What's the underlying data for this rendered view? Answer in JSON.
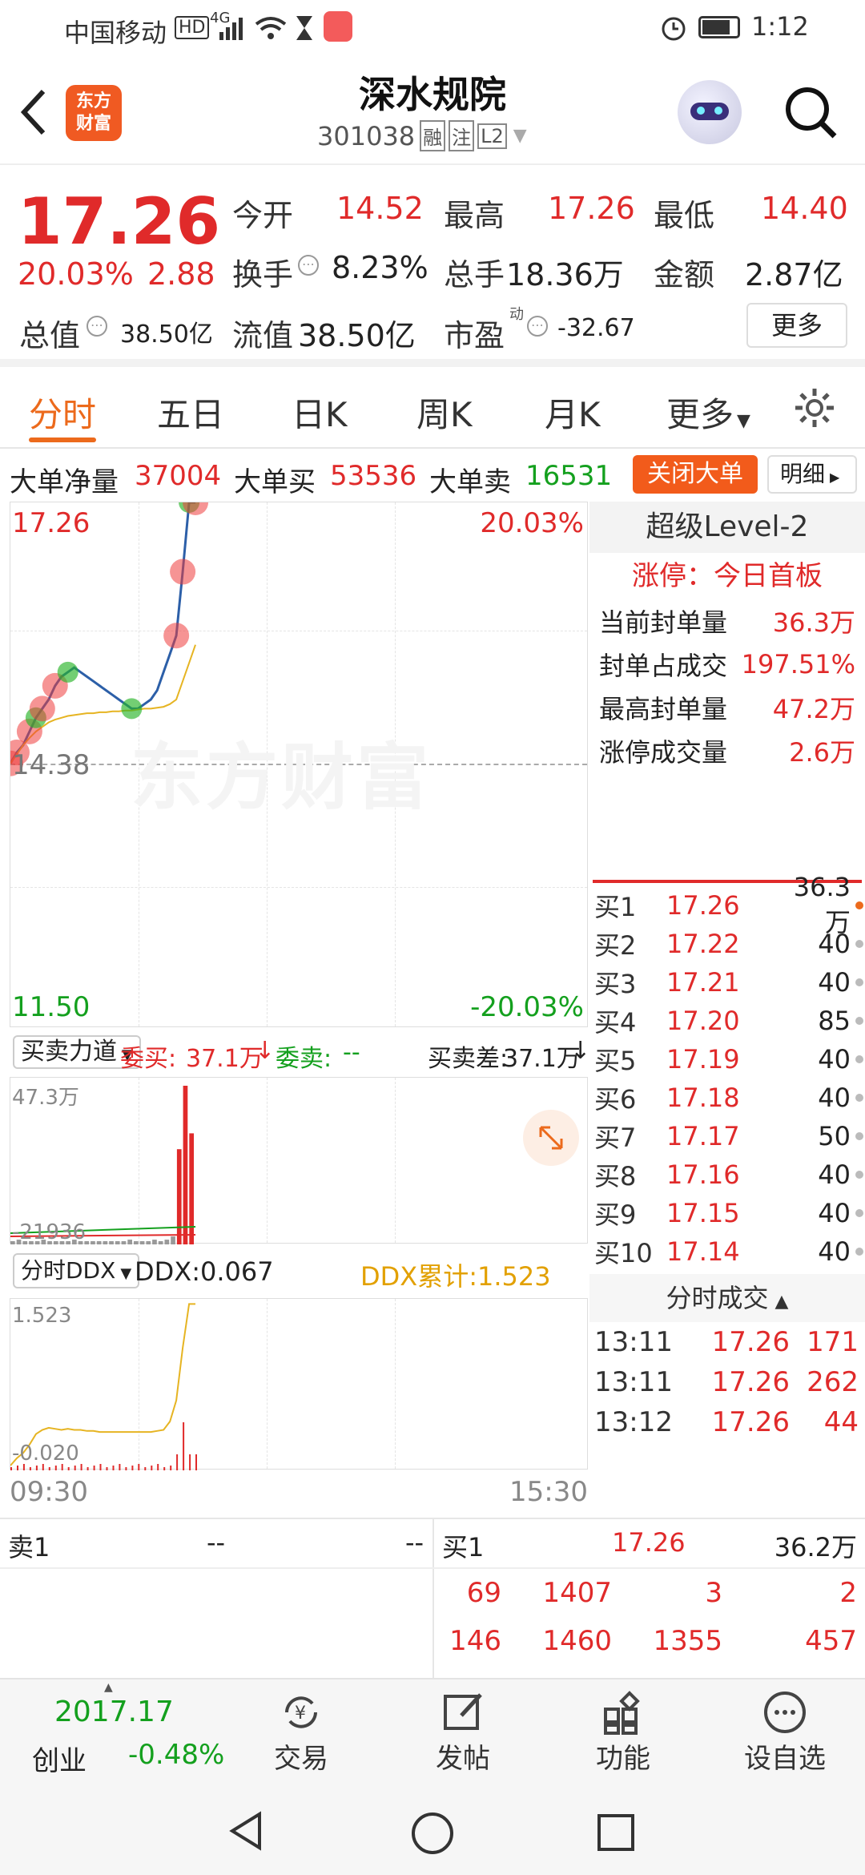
{
  "status": {
    "carrier": "中国移动",
    "hd": "HD",
    "net": "4G",
    "time": "1:12"
  },
  "header": {
    "logo_line1": "东方",
    "logo_line2": "财富",
    "title": "深水规院",
    "code": "301038",
    "tag1": "融",
    "tag2": "注",
    "tag3": "L2"
  },
  "quote": {
    "price": "17.26",
    "change_pct": "20.03%",
    "change": "2.88",
    "open_label": "今开",
    "open": "14.52",
    "high_label": "最高",
    "high": "17.26",
    "low_label": "最低",
    "low": "14.40",
    "turnover_label": "换手",
    "turnover": "8.23%",
    "volume_label": "总手",
    "volume": "18.36万",
    "amount_label": "金额",
    "amount": "2.87亿",
    "mktcap_label": "总值",
    "mktcap": "38.50亿",
    "float_label": "流值",
    "float_cap": "38.50亿",
    "pe_label": "市盈",
    "pe_sup": "动",
    "pe": "-32.67",
    "more_button": "更多"
  },
  "tabs": [
    "分时",
    "五日",
    "日K",
    "周K",
    "月K",
    "更多"
  ],
  "bigorder": {
    "net_label": "大单净量",
    "net": "37004",
    "buy_label": "大单买",
    "buy": "53536",
    "sell_label": "大单卖",
    "sell": "16531",
    "close_btn": "关闭大单",
    "detail_btn": "明细"
  },
  "main_chart": {
    "top_price": "17.26",
    "top_pct": "20.03%",
    "mid_price": "14.38",
    "bottom_price": "11.50",
    "bottom_pct": "-20.03%",
    "watermark": "东方财富"
  },
  "chart_data": [
    {
      "type": "line",
      "series": [
        {
          "values": [
            14.4,
            14.52,
            14.6,
            14.75,
            14.9,
            15.0,
            15.1,
            15.25,
            15.35,
            15.4,
            15.45,
            15.4,
            15.35,
            15.3,
            15.25,
            15.2,
            15.15,
            15.1,
            15.05,
            15.0,
            15.0,
            15.05,
            15.1,
            15.2,
            15.4,
            15.6,
            15.8,
            16.5,
            17.26,
            17.26
          ]
        },
        {
          "values": [
            14.4,
            14.5,
            14.6,
            14.68,
            14.75,
            14.8,
            14.85,
            14.88,
            14.9,
            14.92,
            14.93,
            14.94,
            14.95,
            14.95,
            14.96,
            14.96,
            14.97,
            14.97,
            14.98,
            14.98,
            14.99,
            15.0,
            15.0,
            15.01,
            15.02,
            15.05,
            15.1,
            15.3,
            15.5,
            15.7
          ]
        }
      ],
      "ylim": [
        11.5,
        17.26
      ]
    },
    {
      "type": "bar",
      "values": [
        2,
        3,
        2,
        2,
        2,
        3,
        2,
        2,
        2,
        2,
        3,
        2,
        2,
        2,
        2,
        2,
        2,
        2,
        2,
        3,
        2,
        2,
        2,
        3,
        2,
        3,
        5,
        60,
        100,
        70
      ],
      "ylim": [
        0,
        47.3
      ]
    },
    {
      "type": "line",
      "series": [
        {
          "values": [
            -0.02,
            0.05,
            0.1,
            0.18,
            0.28,
            0.32,
            0.34,
            0.33,
            0.32,
            0.33,
            0.32,
            0.32,
            0.31,
            0.31,
            0.3,
            0.3,
            0.3,
            0.3,
            0.3,
            0.3,
            0.3,
            0.3,
            0.3,
            0.31,
            0.32,
            0.4,
            0.6,
            1.1,
            1.52,
            1.52
          ]
        }
      ],
      "ylim": [
        -0.02,
        1.523
      ]
    }
  ],
  "volume_panel": {
    "selector": "买卖力道",
    "weibuy_label": "委买:",
    "weibuy": "37.1万",
    "weisell_label": "委卖:",
    "weisell": "--",
    "diff_label": "买卖差:",
    "diff": "37.1万",
    "top": "47.3万",
    "bottom": "-21936"
  },
  "ddx_panel": {
    "selector": "分时DDX",
    "ddx": "DDX:0.067",
    "ddx_sum": "DDX累计:1.523",
    "top": "1.523",
    "bottom": "-0.020"
  },
  "time_axis": {
    "start": "09:30",
    "end": "15:30"
  },
  "right_panel": {
    "title": "超级Level-2",
    "limit_text": "涨停：今日首板",
    "rows": [
      {
        "label": "当前封单量",
        "value": "36.3万"
      },
      {
        "label": "封单占成交",
        "value": "197.51%"
      },
      {
        "label": "最高封单量",
        "value": "47.2万"
      },
      {
        "label": "涨停成交量",
        "value": "2.6万"
      }
    ],
    "bids": [
      {
        "label": "买1",
        "price": "17.26",
        "qty": "36.3万"
      },
      {
        "label": "买2",
        "price": "17.22",
        "qty": "40"
      },
      {
        "label": "买3",
        "price": "17.21",
        "qty": "40"
      },
      {
        "label": "买4",
        "price": "17.20",
        "qty": "85"
      },
      {
        "label": "买5",
        "price": "17.19",
        "qty": "40"
      },
      {
        "label": "买6",
        "price": "17.18",
        "qty": "40"
      },
      {
        "label": "买7",
        "price": "17.17",
        "qty": "50"
      },
      {
        "label": "买8",
        "price": "17.16",
        "qty": "40"
      },
      {
        "label": "买9",
        "price": "17.15",
        "qty": "40"
      },
      {
        "label": "买10",
        "price": "17.14",
        "qty": "40"
      }
    ],
    "trades_title": "分时成交",
    "trades": [
      {
        "time": "13:11",
        "price": "17.26",
        "vol": "171"
      },
      {
        "time": "13:11",
        "price": "17.26",
        "vol": "262"
      },
      {
        "time": "13:12",
        "price": "17.26",
        "vol": "44"
      }
    ]
  },
  "bottom_table": {
    "sell_label": "卖1",
    "sell_mid": "--",
    "sell_right": "--",
    "buy_label": "买1",
    "buy_price": "17.26",
    "buy_qty": "36.2万",
    "row1": [
      "69",
      "1407",
      "3",
      "2"
    ],
    "row2": [
      "146",
      "1460",
      "1355",
      "457"
    ]
  },
  "nav": {
    "index_value": "2017.17",
    "index_name": "创业",
    "index_change": "-0.48%",
    "items": [
      "交易",
      "发帖",
      "功能",
      "设自选"
    ]
  }
}
